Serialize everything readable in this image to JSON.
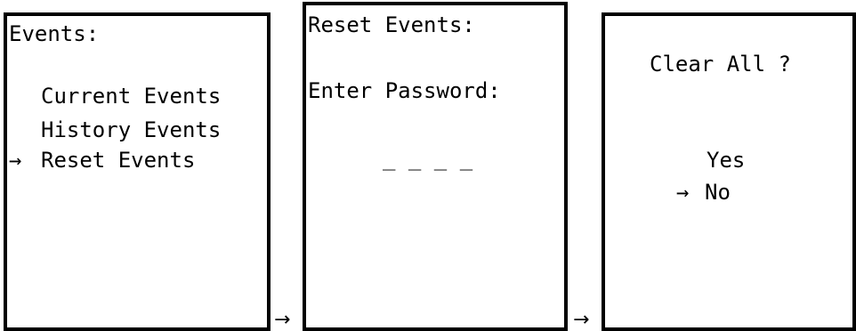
{
  "screens": [
    {
      "title": "Events:",
      "menu": [
        {
          "label": "Current Events",
          "selected": false
        },
        {
          "label": "History Events",
          "selected": false
        },
        {
          "label": "Reset Events",
          "selected": true
        }
      ]
    },
    {
      "title": "Reset Events:",
      "prompt": "Enter Password:",
      "password_mask": "_ _ _ _"
    },
    {
      "title": "Clear All ?",
      "options": [
        {
          "label": "Yes",
          "selected": false
        },
        {
          "label": "No",
          "selected": true
        }
      ]
    }
  ],
  "selection_arrow": "→",
  "flow_arrow": "→"
}
